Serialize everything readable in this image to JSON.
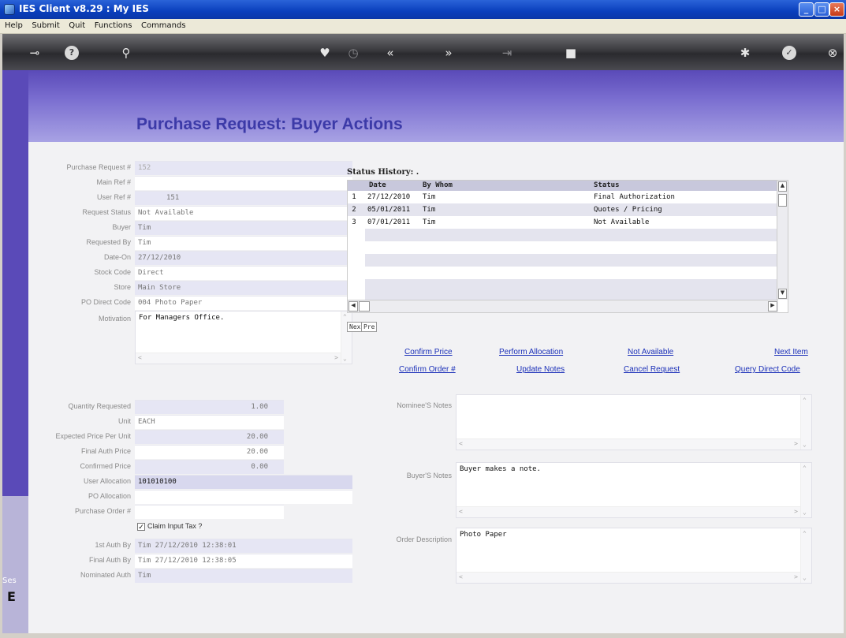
{
  "window": {
    "title": "IES Client v8.29 : My IES"
  },
  "menu": [
    "Help",
    "Submit",
    "Quit",
    "Functions",
    "Commands"
  ],
  "toolbar": {
    "icons": [
      "key-icon",
      "help-icon",
      "search-icon",
      "heart-icon",
      "clock-icon",
      "back-icon",
      "forward-icon",
      "tab-icon",
      "stop-icon",
      "settings-icon",
      "ok-icon",
      "close-icon"
    ],
    "help_glyph": "?"
  },
  "page": {
    "title": "Purchase Request: Buyer Actions"
  },
  "side": {
    "ses": "Ses",
    "e": "E"
  },
  "form": {
    "purchase_request_no": {
      "label": "Purchase Request #",
      "value": "152"
    },
    "main_ref": {
      "label": "Main Ref #",
      "value": ""
    },
    "user_ref": {
      "label": "User Ref #",
      "value": "151"
    },
    "request_status": {
      "label": "Request Status",
      "value": "Not Available"
    },
    "buyer": {
      "label": "Buyer",
      "value": "Tim"
    },
    "requested_by": {
      "label": "Requested By",
      "value": "Tim"
    },
    "date_on": {
      "label": "Date-On",
      "value": "27/12/2010"
    },
    "stock_code": {
      "label": "Stock Code",
      "value": "Direct"
    },
    "store": {
      "label": "Store",
      "value": "Main Store"
    },
    "po_direct_code": {
      "label": "PO Direct Code",
      "value": "004 Photo Paper"
    },
    "motivation": {
      "label": "Motivation",
      "value": "For Managers Office."
    },
    "quantity_requested": {
      "label": "Quantity Requested",
      "value": "1.00"
    },
    "unit": {
      "label": "Unit",
      "value": "EACH"
    },
    "expected_price": {
      "label": "Expected Price Per Unit",
      "value": "20.00"
    },
    "final_auth_price": {
      "label": "Final Auth Price",
      "value": "20.00"
    },
    "confirmed_price": {
      "label": "Confirmed Price",
      "value": "0.00"
    },
    "user_allocation": {
      "label": "User Allocation",
      "value": "101010100"
    },
    "po_allocation": {
      "label": "PO Allocation",
      "value": ""
    },
    "purchase_order_no": {
      "label": "Purchase Order #",
      "value": ""
    },
    "claim_input_tax": {
      "label": "Claim Input Tax ?",
      "checked": true,
      "mark": "✓"
    },
    "first_auth_by": {
      "label": "1st Auth By",
      "value": "Tim 27/12/2010 12:38:01"
    },
    "final_auth_by": {
      "label": "Final Auth By",
      "value": "Tim 27/12/2010 12:38:05"
    },
    "nominated_auth": {
      "label": "Nominated Auth",
      "value": "Tim"
    }
  },
  "status_history": {
    "title": "Status History: .",
    "columns": [
      "Date",
      "By Whom",
      "Status"
    ],
    "rows": [
      {
        "n": "1",
        "date": "27/12/2010",
        "by": "Tim",
        "status": "Final Authorization"
      },
      {
        "n": "2",
        "date": "05/01/2011",
        "by": "Tim",
        "status": "Quotes / Pricing"
      },
      {
        "n": "3",
        "date": "07/01/2011",
        "by": "Tim",
        "status": "Not Available"
      }
    ],
    "nav": {
      "next": "Nex",
      "prev": "Pre"
    }
  },
  "actions": {
    "confirm_price": "Confirm Price",
    "perform_allocation": "Perform Allocation",
    "not_available": "Not Available",
    "next_item": "Next Item",
    "confirm_order": "Confirm Order #",
    "update_notes": "Update Notes",
    "cancel_request": "Cancel Request",
    "query_direct_code": "Query Direct Code"
  },
  "notes": {
    "nominee": {
      "label": "Nominee'S Notes",
      "value": ""
    },
    "buyer": {
      "label": "Buyer'S Notes",
      "value": "Buyer makes a note."
    },
    "order_description": {
      "label": "Order Description",
      "value": "Photo Paper"
    }
  }
}
